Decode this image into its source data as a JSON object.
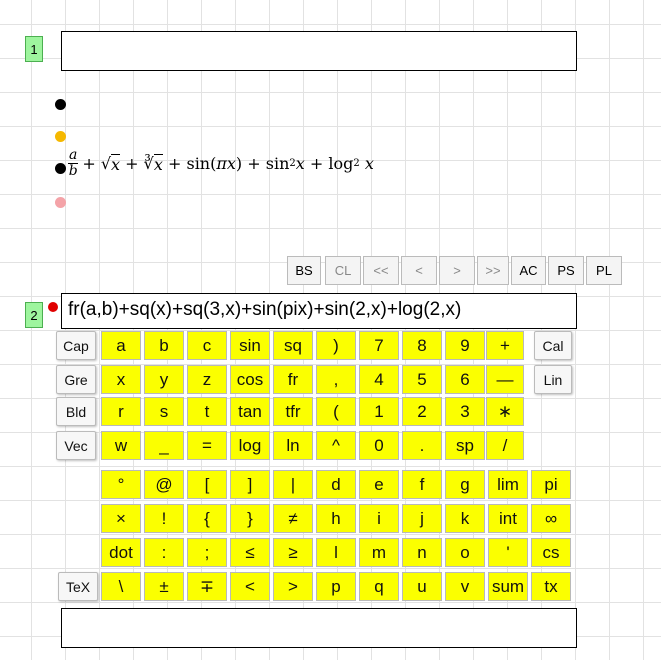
{
  "cells": [
    {
      "number": "1",
      "value": ""
    },
    {
      "number": "2",
      "value": "fr(a,b)+sq(x)+sq(3,x)+sin(pix)+sin(2,x)+log(2,x)"
    },
    {
      "number": "",
      "value": ""
    }
  ],
  "formula": {
    "frac_num": "a",
    "frac_den": "b",
    "t1": "+ √",
    "t1v": "x",
    "t2": "+ ∛",
    "t2v": "x",
    "t3": "+ sin(",
    "t3v": "πx",
    ")": "",
    "t3c": ") +",
    "t4": "sin",
    "t4s": "2",
    "t4v": "x",
    "t5": "+ log",
    "t5s": "2",
    "t5v": "x"
  },
  "nav_buttons": [
    "BS",
    "CL",
    "<<",
    "<",
    ">",
    ">>",
    "AC",
    "PS",
    "PL"
  ],
  "side_left": [
    "Cap",
    "Gre",
    "Bld",
    "Vec"
  ],
  "side_right": [
    "Cal",
    "Lin"
  ],
  "tex_button": "TeX",
  "keypad_top": [
    [
      "a",
      "b",
      "c",
      "sin",
      "sq",
      ")",
      "7",
      "8",
      "9",
      "+"
    ],
    [
      "x",
      "y",
      "z",
      "cos",
      "fr",
      ",",
      "4",
      "5",
      "6",
      "—"
    ],
    [
      "r",
      "s",
      "t",
      "tan",
      "tfr",
      "(",
      "1",
      "2",
      "3",
      "∗"
    ],
    [
      "w",
      "_",
      "=",
      "log",
      "ln",
      "^",
      "0",
      ".",
      "sp",
      "/"
    ]
  ],
  "keypad_bottom": [
    [
      "°",
      "@",
      "[",
      "]",
      "|",
      "d",
      "e",
      "f",
      "g",
      "lim",
      "pi"
    ],
    [
      "×",
      "!",
      "{",
      "}",
      "≠",
      "h",
      "i",
      "j",
      "k",
      "int",
      "∞"
    ],
    [
      "dot",
      ":",
      ";",
      "≤",
      "≥",
      "l",
      "m",
      "n",
      "o",
      "'",
      "cs"
    ],
    [
      "\\",
      "±",
      "∓",
      "<",
      ">",
      "p",
      "q",
      "u",
      "v",
      "sum",
      "tx"
    ]
  ],
  "colors": {
    "key_bg": "#fbff00",
    "cell_number_bg": "#9ef59e",
    "dot_black": "#000000",
    "dot_orange": "#f5b800",
    "dot_pink": "#f4a3a8",
    "dot_red": "#e00000"
  }
}
